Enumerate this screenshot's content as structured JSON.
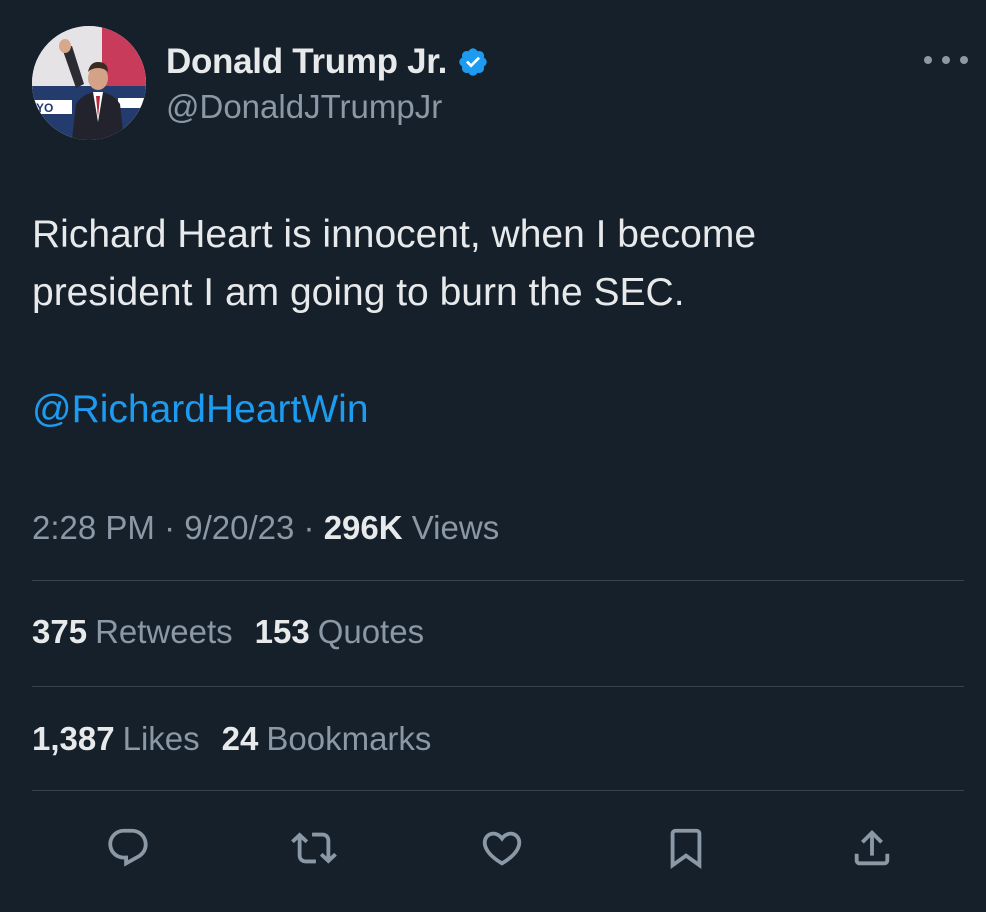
{
  "author": {
    "display_name": "Donald Trump Jr.",
    "handle": "@DonaldJTrumpJr",
    "verified": true,
    "avatar_icon": "profile-photo"
  },
  "tweet": {
    "text_line_1": "Richard Heart is innocent, when I become",
    "text_line_2": "president I am going to burn the SEC.",
    "mention": "@RichardHeartWin",
    "time": "2:28 PM",
    "separator": "·",
    "date": "9/20/23",
    "views_count": "296K",
    "views_label": "Views"
  },
  "stats": {
    "retweets_count": "375",
    "retweets_label": "Retweets",
    "quotes_count": "153",
    "quotes_label": "Quotes",
    "likes_count": "1,387",
    "likes_label": "Likes",
    "bookmarks_count": "24",
    "bookmarks_label": "Bookmarks"
  },
  "actions": [
    "reply-icon",
    "retweet-icon",
    "like-icon",
    "bookmark-icon",
    "share-icon"
  ],
  "colors": {
    "background": "#15202b",
    "text": "#e7e9ea",
    "muted": "#8b98a5",
    "link": "#1d9bf0",
    "divider": "#38444d"
  }
}
